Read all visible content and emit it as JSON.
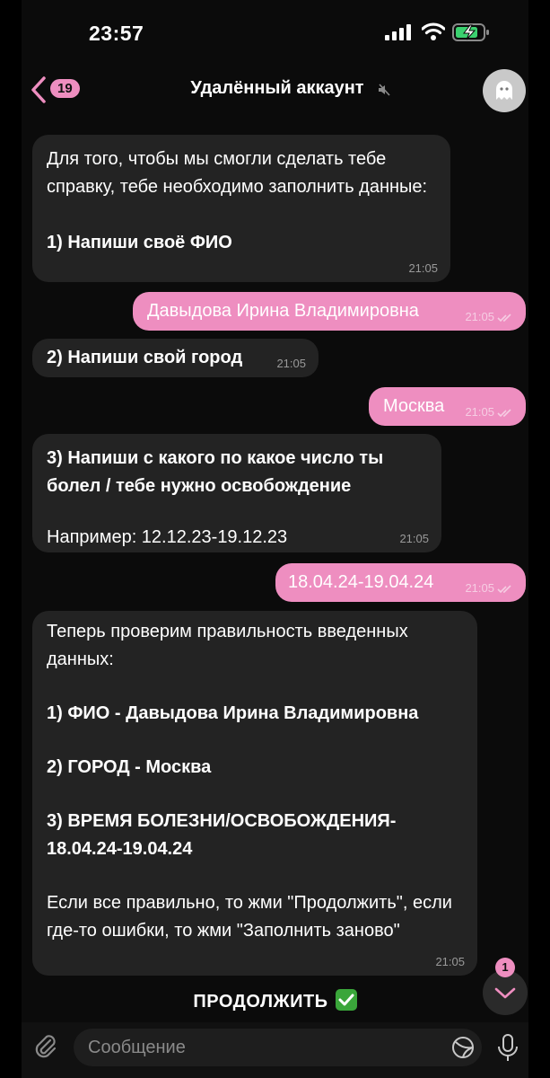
{
  "status": {
    "time": "23:57"
  },
  "header": {
    "unread_count": "19",
    "title": "Удалённый аккаунт"
  },
  "messages": [
    {
      "direction": "in",
      "text": "Для того, чтобы мы смогли сделать тебе справку, тебе необходимо заполнить данные:\n\n",
      "bold_text": "1) Напиши своё ФИО",
      "time": "21:05"
    },
    {
      "direction": "out",
      "text": "Давыдова Ирина Владимировна",
      "time": "21:05"
    },
    {
      "direction": "in",
      "bold_text": "2) Напиши свой город",
      "time": "21:05"
    },
    {
      "direction": "out",
      "text": "Москва",
      "time": "21:05"
    },
    {
      "direction": "in",
      "bold_text": "3) Напиши с какого по какое число ты болел / тебе нужно освобождение",
      "text": "Например: 12.12.23-19.12.23",
      "time": "21:05"
    },
    {
      "direction": "out",
      "text": "18.04.24-19.04.24",
      "time": "21:05"
    },
    {
      "direction": "in",
      "intro": "Теперь проверим правильность введенных данных:",
      "line1": "1) ФИО - Давыдова Ирина Владимировна",
      "line2": "2) ГОРОД - Москва",
      "line3": "3) ВРЕМЯ БОЛЕЗНИ/ОСВОБОЖДЕНИЯ- 18.04.24-19.04.24",
      "outro": "Если все правильно, то жми \"Продолжить\", если где-то ошибки, то жми \"Заполнить заново\"",
      "time": "21:05"
    }
  ],
  "keyboard": {
    "continue_label": "ПРОДОЛЖИТЬ"
  },
  "scroll_down": {
    "badge": "1"
  },
  "composer": {
    "placeholder": "Сообщение"
  },
  "colors": {
    "accent": "#ee8ec0",
    "incoming_bubble": "#232323",
    "background": "#0b0b0b"
  },
  "icons": [
    "signal-icon",
    "wifi-icon",
    "battery-charging-icon",
    "back-chevron-icon",
    "muted-icon",
    "ghost-avatar-icon",
    "double-check-icon",
    "check-mark-icon",
    "chevron-down-icon",
    "paperclip-icon",
    "sticker-icon",
    "microphone-icon"
  ]
}
